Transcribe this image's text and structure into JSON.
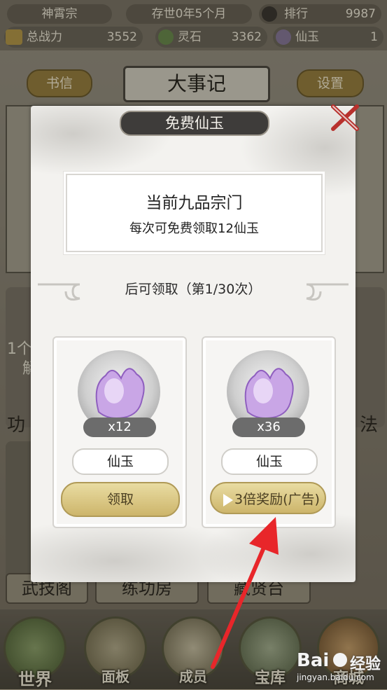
{
  "top_bar": {
    "sect_name": "神霄宗",
    "era": "存世0年5个月",
    "rank_label": "排行",
    "rank_value": "9987",
    "power_label": "总战力",
    "power_value": "3552",
    "spirit_stone_label": "灵石",
    "spirit_stone_value": "3362",
    "jade_label": "仙玉",
    "jade_value": "1"
  },
  "header": {
    "letters_label": "书信",
    "title": "大事记",
    "settings_label": "设置"
  },
  "background_buildings": {
    "left_label_partial": "功",
    "right_label_partial": "法",
    "left_bubble_text": "1个",
    "left_bubble_text2": "解",
    "wujige_label": "武技阁",
    "training_label": "练功房",
    "hall_label": "藏贤台"
  },
  "bottom_nav": {
    "items": [
      {
        "label": "世界"
      },
      {
        "label": "面板"
      },
      {
        "label": "成员"
      },
      {
        "label": "宝库"
      },
      {
        "label": "商城"
      }
    ]
  },
  "modal": {
    "title": "免费仙玉",
    "info_title": "当前九品宗门",
    "info_subtitle": "每次可免费领取12仙玉",
    "claim_text": "后可领取（第1/30次）",
    "cards": [
      {
        "count": "x12",
        "item_name": "仙玉",
        "button_label": "领取"
      },
      {
        "count": "x36",
        "item_name": "仙玉",
        "button_label": "3倍奖励(广告)"
      }
    ]
  },
  "watermark": {
    "brand": "Bai",
    "brand2": "经验",
    "url": "jingyan.baidu.com"
  },
  "colors": {
    "arrow": "#e8262a",
    "button_gold": "#cdb56b",
    "title_bg": "#3e3c3a"
  }
}
